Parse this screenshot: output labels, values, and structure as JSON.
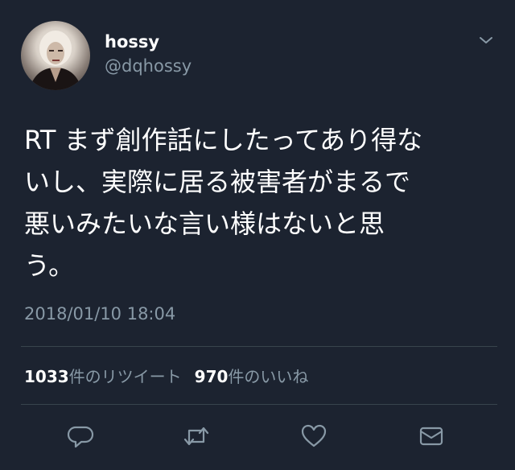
{
  "user": {
    "display_name": "hossy",
    "handle": "@dqhossy",
    "avatar_icon": "user-avatar"
  },
  "tweet": {
    "text": "RT まず創作話にしたってあり得な\nいし、実際に居る被害者がまるで\n悪いみたいな言い様はないと思\nう。",
    "timestamp": "2018/01/10 18:04"
  },
  "stats": {
    "retweets_count": "1033",
    "retweets_label": "件のリツイート",
    "likes_count": "970",
    "likes_label": "件のいいね"
  },
  "actions": [
    {
      "icon": "reply-icon"
    },
    {
      "icon": "retweet-icon"
    },
    {
      "icon": "like-icon"
    },
    {
      "icon": "direct-message-icon"
    }
  ],
  "colors": {
    "background": "#1c2330",
    "primary_text": "#ffffff",
    "secondary_text": "#8899a6",
    "divider": "#38444d"
  }
}
